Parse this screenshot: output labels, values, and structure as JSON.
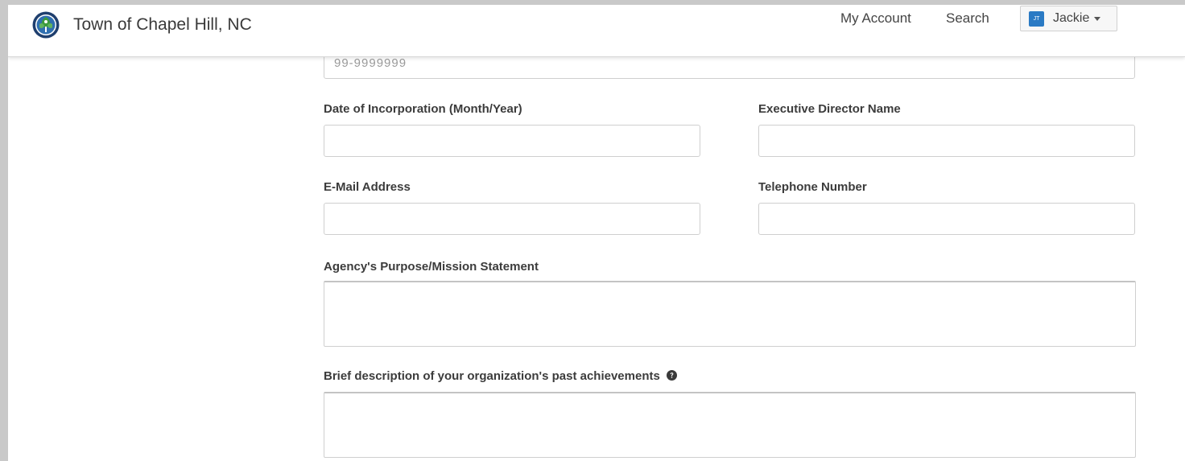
{
  "header": {
    "brand_name": "Town of Chapel Hill, NC",
    "nav": {
      "my_account": "My Account",
      "search": "Search"
    },
    "user": {
      "initials": "JT",
      "name": "Jackie"
    }
  },
  "form": {
    "ein": {
      "placeholder": "99-9999999",
      "value": ""
    },
    "date_of_incorporation": {
      "label": "Date of Incorporation (Month/Year)",
      "value": ""
    },
    "executive_director_name": {
      "label": "Executive Director Name",
      "value": ""
    },
    "email_address": {
      "label": "E-Mail Address",
      "value": ""
    },
    "telephone_number": {
      "label": "Telephone Number",
      "value": ""
    },
    "mission_statement": {
      "label": "Agency's Purpose/Mission Statement",
      "value": ""
    },
    "past_achievements": {
      "label": "Brief description of your organization's past achievements",
      "value": ""
    }
  },
  "icons": {
    "logo": "town-seal-icon",
    "help": "question-circle-icon",
    "caret": "caret-down-icon"
  },
  "colors": {
    "avatar": "#2a7ac4",
    "background": "#ffffff",
    "outer": "#c9c9c9"
  }
}
